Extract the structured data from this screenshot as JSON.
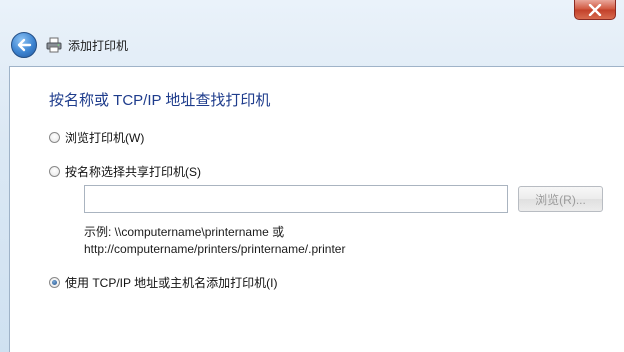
{
  "window": {
    "background_title": "",
    "close_icon": "close-x-icon"
  },
  "toolbar": {
    "back_icon": "back-arrow-icon",
    "printer_icon": "printer-icon",
    "title": "添加打印机"
  },
  "main": {
    "heading": "按名称或 TCP/IP 地址查找打印机",
    "options": [
      {
        "label": "浏览打印机(W)",
        "checked": false
      },
      {
        "label": "按名称选择共享打印机(S)",
        "checked": false
      },
      {
        "label": "使用 TCP/IP 地址或主机名添加打印机(I)",
        "checked": true
      }
    ],
    "share_name_input": {
      "value": "",
      "placeholder": ""
    },
    "browse_button": "浏览(R)...",
    "example_line1": "示例: \\\\computername\\printername 或",
    "example_line2": "http://computername/printers/printername/.printer"
  },
  "colors": {
    "heading": "#1e3c8c",
    "frame": "#dbe8f4",
    "close_button": "#c3402a"
  }
}
